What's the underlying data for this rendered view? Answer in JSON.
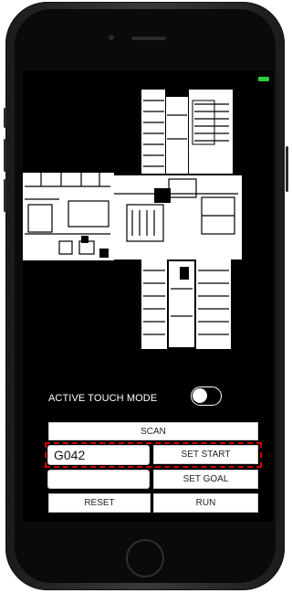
{
  "screen": {
    "touch_mode_label": "ACTIVE TOUCH MODE",
    "touch_mode_on": true
  },
  "controls": {
    "scan_label": "SCAN",
    "start_value": "G042",
    "start_placeholder": "",
    "set_start_label": "SET START",
    "goal_value": "",
    "set_goal_label": "SET GOAL",
    "reset_label": "RESET",
    "run_label": "RUN"
  },
  "colors": {
    "background": "#000000",
    "battery": "#2ecc40",
    "highlight": "#d10000"
  }
}
